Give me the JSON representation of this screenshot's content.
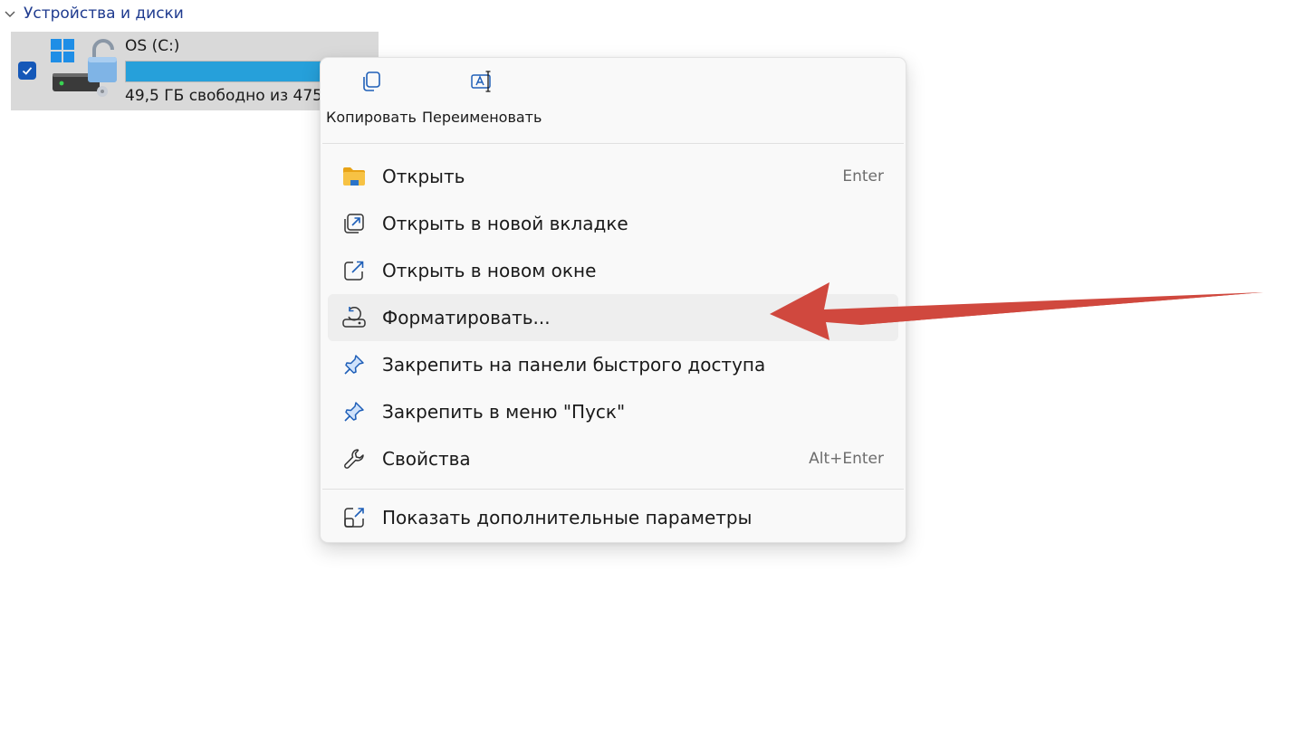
{
  "section": {
    "title": "Устройства и диски",
    "chevron_icon": "chevron-down-icon"
  },
  "drive": {
    "name": "OS (C:)",
    "free_text": "49,5 ГБ свободно из 475",
    "used_fraction": 0.9,
    "selected": true,
    "icon": "bitlocker-drive-icon",
    "bar_color": "#26a0da"
  },
  "menu": {
    "quick_actions": [
      {
        "label": "Копировать",
        "icon": "copy-icon"
      },
      {
        "label": "Переименовать",
        "icon": "rename-icon"
      }
    ],
    "items": [
      {
        "label": "Открыть",
        "shortcut": "Enter",
        "icon": "folder-icon"
      },
      {
        "label": "Открыть в новой вкладке",
        "shortcut": "",
        "icon": "open-new-tab-icon"
      },
      {
        "label": "Открыть в новом окне",
        "shortcut": "",
        "icon": "open-new-window-icon"
      },
      {
        "label": "Форматировать...",
        "shortcut": "",
        "icon": "format-drive-icon",
        "highlighted": true
      },
      {
        "label": "Закрепить на панели быстрого доступа",
        "shortcut": "",
        "icon": "pin-icon"
      },
      {
        "label": "Закрепить в меню \"Пуск\"",
        "shortcut": "",
        "icon": "pin-icon"
      },
      {
        "label": "Свойства",
        "shortcut": "Alt+Enter",
        "icon": "wrench-icon"
      }
    ],
    "more_options": {
      "label": "Показать дополнительные параметры",
      "icon": "more-options-icon"
    }
  },
  "annotation": {
    "arrow_color": "#d0483e",
    "points_to": "Форматировать..."
  }
}
